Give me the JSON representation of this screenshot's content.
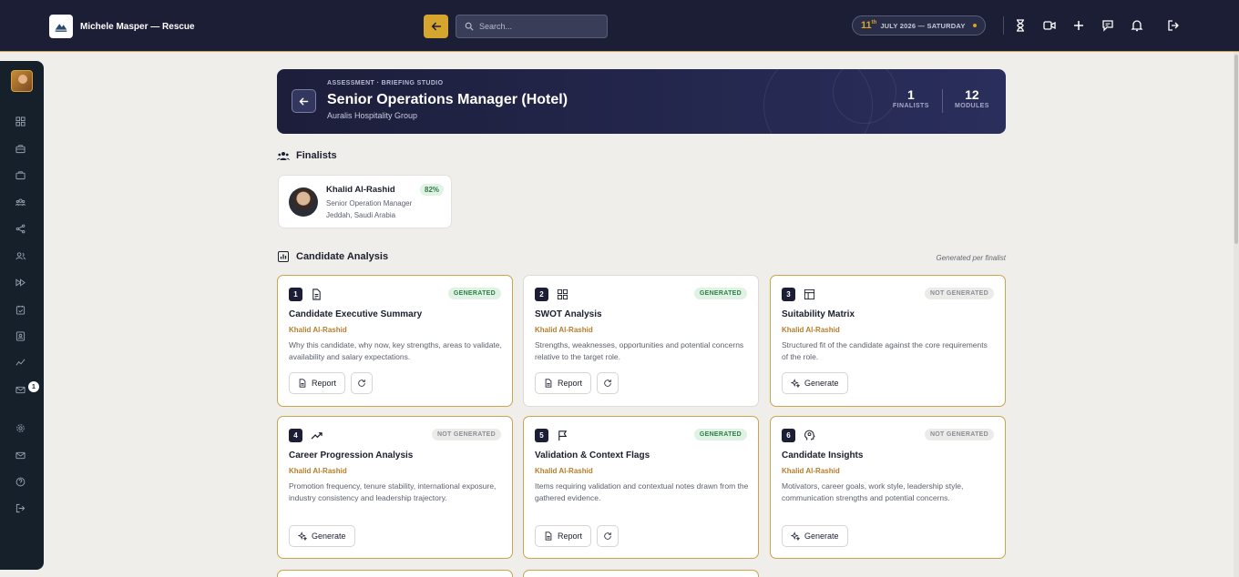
{
  "topbar": {
    "brand_name": "Michele Masper — Rescue",
    "search_placeholder": "Search...",
    "date_day": "11",
    "date_suffix": "th",
    "date_text": "JULY 2026 — SATURDAY",
    "icons": [
      "hourglass-icon",
      "video-icon",
      "plus-icon",
      "chat-icon",
      "bell-icon",
      "logout-icon"
    ]
  },
  "sidebar": {
    "badge_count": "1",
    "icons": [
      "dashboard-icon",
      "briefcase-icon",
      "suitcase-icon",
      "users-icon",
      "share-icon",
      "team-icon",
      "fast-forward-icon",
      "calendar-check-icon",
      "contact-card-icon",
      "trend-icon",
      "mail-icon",
      "settings-icon",
      "envelope-icon",
      "help-icon",
      "logout-icon"
    ]
  },
  "hero": {
    "kicker": "ASSESSMENT · BRIEFING STUDIO",
    "title": "Senior Operations Manager (Hotel)",
    "subtitle": "Auralis Hospitality Group",
    "stats": [
      {
        "value": "1",
        "label": "FINALISTS"
      },
      {
        "value": "12",
        "label": "MODULES"
      }
    ]
  },
  "finalists": {
    "title": "Finalists",
    "items": [
      {
        "name": "Khalid Al-Rashid",
        "score": "82%",
        "role": "Senior Operation Manager",
        "location": "Jeddah, Saudi Arabia"
      }
    ]
  },
  "analysis": {
    "title": "Candidate Analysis",
    "note": "Generated per finalist",
    "report_label": "Report",
    "generate_label": "Generate",
    "cards": [
      {
        "num": "1",
        "icon": "document-icon",
        "status": "GENERATED",
        "title": "Candidate Executive Summary",
        "candidate": "Khalid Al-Rashid",
        "desc": "Why this candidate, why now, key strengths, areas to validate, availability and salary expectations."
      },
      {
        "num": "2",
        "icon": "grid-icon",
        "status": "GENERATED",
        "title": "SWOT Analysis",
        "candidate": "Khalid Al-Rashid",
        "desc": "Strengths, weaknesses, opportunities and potential concerns relative to the target role."
      },
      {
        "num": "3",
        "icon": "table-icon",
        "status": "NOT GENERATED",
        "title": "Suitability Matrix",
        "candidate": "Khalid Al-Rashid",
        "desc": "Structured fit of the candidate against the core requirements of the role."
      },
      {
        "num": "4",
        "icon": "trending-up-icon",
        "status": "NOT GENERATED",
        "title": "Career Progression Analysis",
        "candidate": "Khalid Al-Rashid",
        "desc": "Promotion frequency, tenure stability, international exposure, industry consistency and leadership trajectory."
      },
      {
        "num": "5",
        "icon": "flag-icon",
        "status": "GENERATED",
        "title": "Validation & Context Flags",
        "candidate": "Khalid Al-Rashid",
        "desc": "Items requiring validation and contextual notes drawn from the gathered evidence."
      },
      {
        "num": "6",
        "icon": "brain-icon",
        "status": "NOT GENERATED",
        "title": "Candidate Insights",
        "candidate": "Khalid Al-Rashid",
        "desc": "Motivators, career goals, work style, leadership style, communication strengths and potential concerns."
      }
    ]
  }
}
